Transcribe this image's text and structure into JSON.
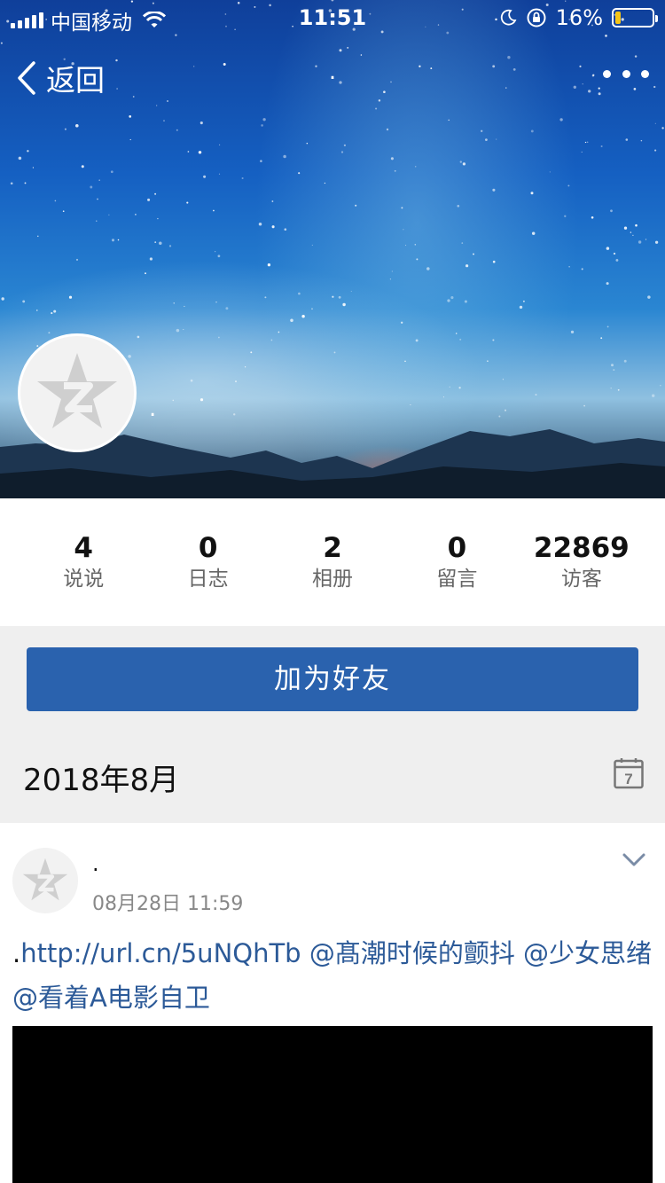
{
  "status_bar": {
    "carrier": "中国移动",
    "time": "11:51",
    "battery_percent": "16%",
    "battery_level": 0.16,
    "battery_color": "#f5c518"
  },
  "nav": {
    "back_label": "返回",
    "title": ".",
    "more_icon": "more-icon"
  },
  "profile": {
    "name": ".",
    "avatar_icon": "qzone-star-icon"
  },
  "stats": [
    {
      "value": "4",
      "label": "说说"
    },
    {
      "value": "0",
      "label": "日志"
    },
    {
      "value": "2",
      "label": "相册"
    },
    {
      "value": "0",
      "label": "留言"
    },
    {
      "value": "22869",
      "label": "访客"
    }
  ],
  "actions": {
    "add_friend_label": "加为好友",
    "accent_color": "#2a62ae"
  },
  "timeline": {
    "month": "2018年8月",
    "calendar_icon": "calendar-icon",
    "calendar_day": "7"
  },
  "post": {
    "author": ".",
    "time": "08月28日 11:59",
    "lead": ".",
    "link": "http://url.cn/5uNQhTb",
    "mentions": [
      "@髙潮时候的颤抖",
      "@少女思绪",
      "@看着A电影自卫"
    ],
    "link_color": "#2c5a98"
  }
}
